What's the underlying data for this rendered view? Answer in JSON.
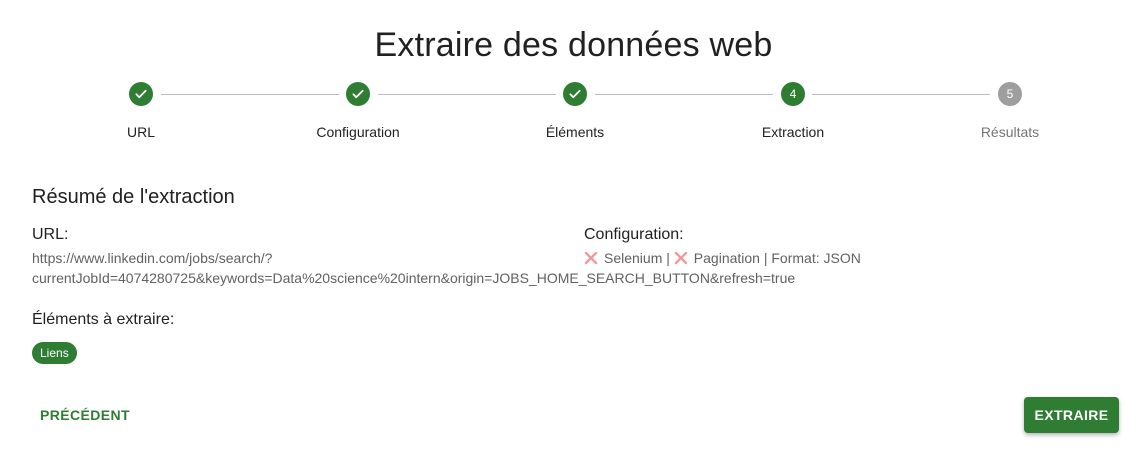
{
  "page": {
    "title": "Extraire des données web"
  },
  "stepper": {
    "steps": [
      {
        "label": "URL",
        "marker": "check-icon"
      },
      {
        "label": "Configuration",
        "marker": "check-icon"
      },
      {
        "label": "Éléments",
        "marker": "check-icon"
      },
      {
        "label": "Extraction",
        "number": "4"
      },
      {
        "label": "Résultats",
        "number": "5"
      }
    ],
    "active_step": "4",
    "colors": {
      "completed": "#2e7d32",
      "active": "#2e7d32",
      "pending": "#9e9e9e"
    }
  },
  "summary": {
    "title": "Résumé de l'extraction",
    "url_label": "URL:",
    "url_value": "https://www.linkedin.com/jobs/search/?currentJobId=4074280725&keywords=Data%20science%20intern&origin=JOBS_HOME_SEARCH_BUTTON&refresh=true",
    "url_line1": "https://www.linkedin.com/jobs/search/?",
    "url_line2": "currentJobId=4074280725&keywords=Data%20science%20intern&origin=JOBS_HOME_SEARCH_BUTTON&refresh=true",
    "config_label": "Configuration:",
    "config": {
      "selenium_icon": "close-icon",
      "selenium_label": "Selenium",
      "separator1": " | ",
      "pagination_icon": "close-icon",
      "pagination_label": "Pagination",
      "format_text": " | Format: JSON"
    },
    "elements_label": "Éléments à extraire:",
    "elements": [
      "Liens"
    ]
  },
  "actions": {
    "previous_label": "PRÉCÉDENT",
    "extract_label": "EXTRAIRE"
  },
  "colors": {
    "primary": "#2e7d32",
    "disabled_x": "#ef9a9a"
  }
}
